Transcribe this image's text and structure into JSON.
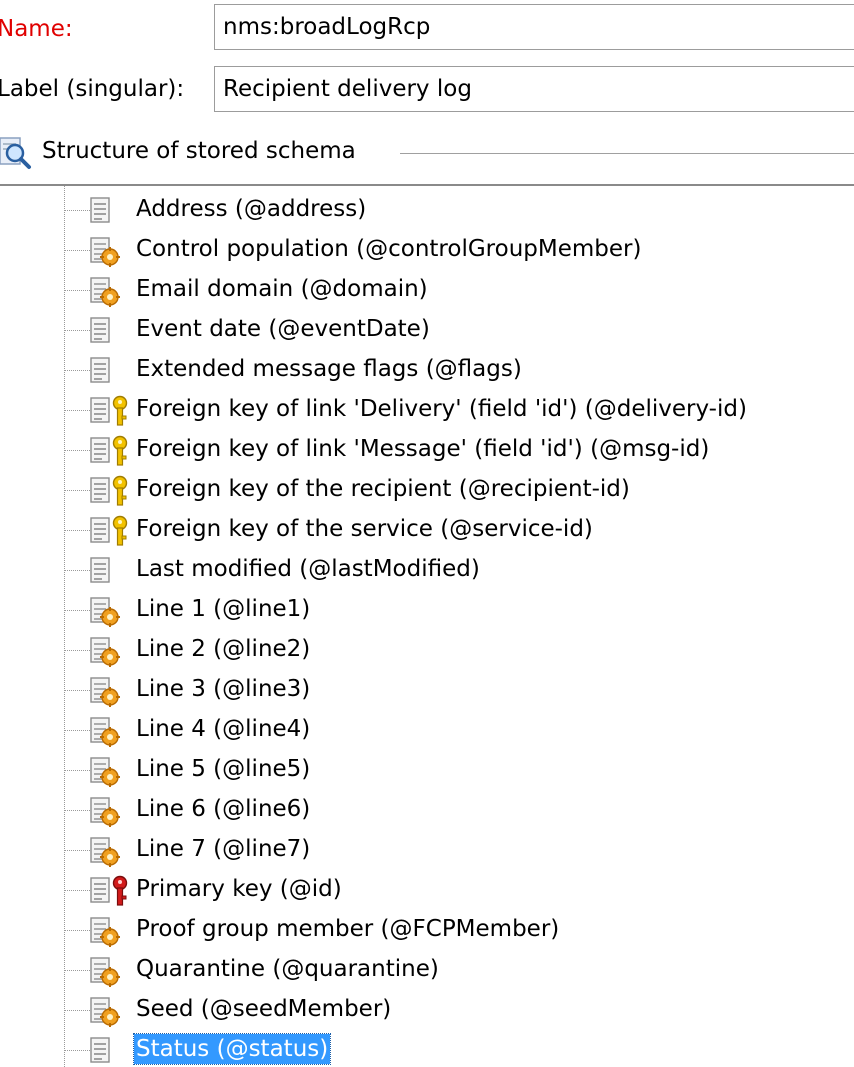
{
  "form": {
    "name_label": "Name:",
    "name_value": "nms:broadLogRcp",
    "label_label": "Label (singular):",
    "label_value": "Recipient delivery log"
  },
  "group": {
    "title": "Structure of stored schema",
    "icon": "magnifier-icon"
  },
  "tree": {
    "items": [
      {
        "label": "Address (@address)",
        "icon": "field-icon"
      },
      {
        "label": "Control population (@controlGroupMember)",
        "icon": "computed-field-icon"
      },
      {
        "label": "Email domain (@domain)",
        "icon": "computed-field-icon"
      },
      {
        "label": "Event date (@eventDate)",
        "icon": "field-icon"
      },
      {
        "label": "Extended message flags (@flags)",
        "icon": "field-icon"
      },
      {
        "label": "Foreign key of link 'Delivery' (field 'id') (@delivery-id)",
        "icon": "foreign-key-icon"
      },
      {
        "label": "Foreign key of link 'Message' (field 'id') (@msg-id)",
        "icon": "foreign-key-icon"
      },
      {
        "label": "Foreign key of the recipient (@recipient-id)",
        "icon": "foreign-key-icon"
      },
      {
        "label": "Foreign key of the service (@service-id)",
        "icon": "foreign-key-icon"
      },
      {
        "label": "Last modified (@lastModified)",
        "icon": "field-icon"
      },
      {
        "label": "Line 1 (@line1)",
        "icon": "computed-field-icon"
      },
      {
        "label": "Line 2 (@line2)",
        "icon": "computed-field-icon"
      },
      {
        "label": "Line 3 (@line3)",
        "icon": "computed-field-icon"
      },
      {
        "label": "Line 4 (@line4)",
        "icon": "computed-field-icon"
      },
      {
        "label": "Line 5 (@line5)",
        "icon": "computed-field-icon"
      },
      {
        "label": "Line 6 (@line6)",
        "icon": "computed-field-icon"
      },
      {
        "label": "Line 7 (@line7)",
        "icon": "computed-field-icon"
      },
      {
        "label": "Primary key (@id)",
        "icon": "primary-key-icon"
      },
      {
        "label": "Proof group member (@FCPMember)",
        "icon": "computed-field-icon"
      },
      {
        "label": "Quarantine (@quarantine)",
        "icon": "computed-field-icon"
      },
      {
        "label": "Seed (@seedMember)",
        "icon": "computed-field-icon"
      },
      {
        "label": "Status (@status)",
        "icon": "field-icon",
        "selected": true
      }
    ]
  },
  "colors": {
    "required_label": "#e00000",
    "selection": "#3399ff",
    "key_yellow": "#f2c200",
    "key_red": "#d21b1b",
    "gear_orange": "#f0a020"
  }
}
